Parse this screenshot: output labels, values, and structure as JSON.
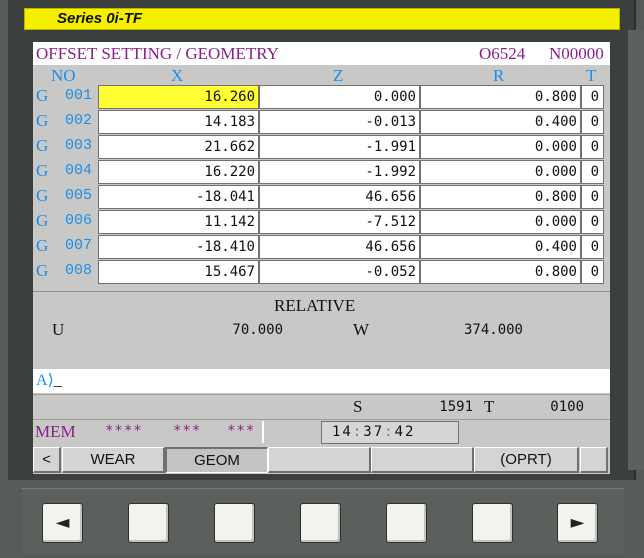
{
  "series": {
    "label": "Series 0i-TF"
  },
  "header": {
    "title": "OFFSET SETTING / GEOMETRY",
    "program": "O6524",
    "sequence": "N00000"
  },
  "columns": {
    "no": "NO",
    "x": "X",
    "z": "Z",
    "r": "R",
    "t": "T"
  },
  "rows": [
    {
      "g": "G",
      "no": "001",
      "x": "16.260",
      "z": "0.000",
      "r": "0.800",
      "t": "0",
      "selected": true
    },
    {
      "g": "G",
      "no": "002",
      "x": "14.183",
      "z": "-0.013",
      "r": "0.400",
      "t": "0"
    },
    {
      "g": "G",
      "no": "003",
      "x": "21.662",
      "z": "-1.991",
      "r": "0.000",
      "t": "0"
    },
    {
      "g": "G",
      "no": "004",
      "x": "16.220",
      "z": "-1.992",
      "r": "0.000",
      "t": "0"
    },
    {
      "g": "G",
      "no": "005",
      "x": "-18.041",
      "z": "46.656",
      "r": "0.800",
      "t": "0"
    },
    {
      "g": "G",
      "no": "006",
      "x": "11.142",
      "z": "-7.512",
      "r": "0.000",
      "t": "0"
    },
    {
      "g": "G",
      "no": "007",
      "x": "-18.410",
      "z": "46.656",
      "r": "0.400",
      "t": "0"
    },
    {
      "g": "G",
      "no": "008",
      "x": "15.467",
      "z": "-0.052",
      "r": "0.800",
      "t": "0"
    }
  ],
  "relative": {
    "title": "RELATIVE",
    "u_label": "U",
    "u_value": "70.000",
    "w_label": "W",
    "w_value": "374.000"
  },
  "input": {
    "prompt": "A",
    "caret": "⟩",
    "cursor": "_"
  },
  "status": {
    "s_label": "S",
    "s_value": "1591",
    "t_label": "T",
    "t_value": "0100",
    "mode": "MEM",
    "field1": "****",
    "field2": "***",
    "field3": "***",
    "clock_h": "14",
    "clock_m": "37",
    "clock_s": "42",
    "clock_sep": ":"
  },
  "softkeys": {
    "prev": "<",
    "wear": "WEAR",
    "geom": "GEOM",
    "blank1": "",
    "blank2": "",
    "oprt": "(OPRT)",
    "next": ""
  },
  "hardkeys": {
    "left": "◄",
    "right": "►"
  },
  "colors": {
    "selected_cell": "#ffff33",
    "label_blue": "#1c8ee8",
    "header_purple": "#8a1f8a",
    "series_yellow": "#f4f000"
  }
}
